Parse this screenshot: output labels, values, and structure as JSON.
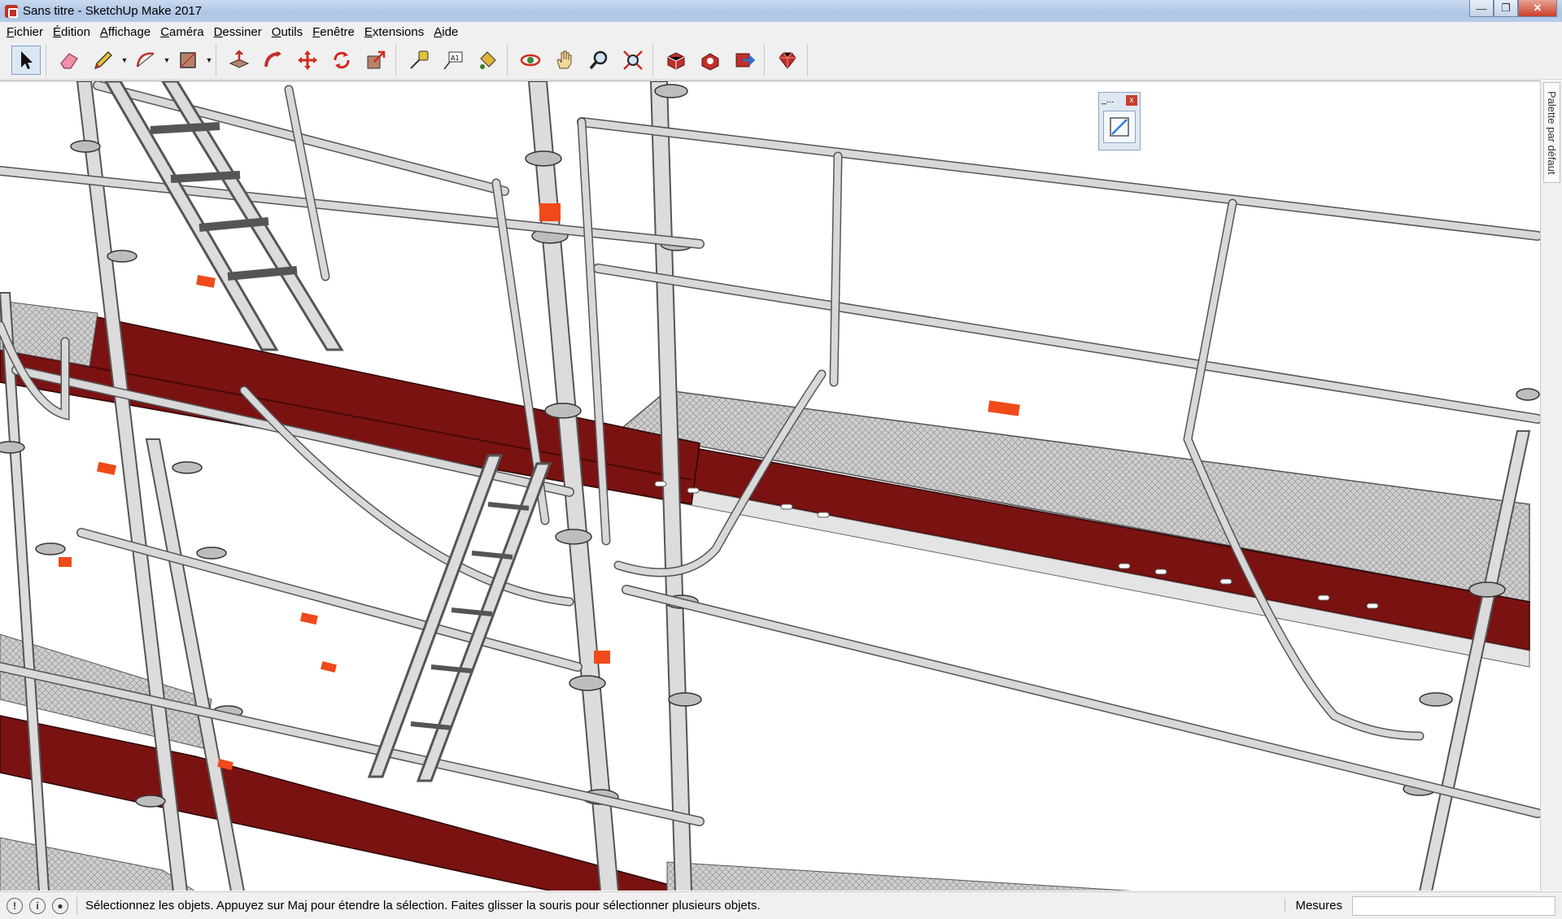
{
  "window": {
    "title": "Sans titre - SketchUp Make 2017",
    "minimize": "—",
    "maximize": "❐",
    "close": "✕"
  },
  "menu": [
    "Fichier",
    "Édition",
    "Affichage",
    "Caméra",
    "Dessiner",
    "Outils",
    "Fenêtre",
    "Extensions",
    "Aide"
  ],
  "toolbar": {
    "tools": [
      "select-tool",
      "eraser-tool",
      "line-tool",
      "arc-tool",
      "rectangle-tool",
      "push-pull-tool",
      "follow-me-tool",
      "move-tool",
      "rotate-tool",
      "scale-tool",
      "tape-measure-tool",
      "text-tool",
      "paint-bucket-tool",
      "orbit-tool",
      "pan-tool",
      "zoom-tool",
      "zoom-extents-tool",
      "warehouse-tool",
      "extension-warehouse-tool",
      "share-model-tool",
      "ruby-tool"
    ]
  },
  "mini_window": {
    "title": "_...",
    "close": "x"
  },
  "tray": {
    "tab_label": "Palette par défaut"
  },
  "status": {
    "message": "Sélectionnez les objets. Appuyez sur Maj pour étendre la sélection. Faites glisser la souris pour sélectionner plusieurs objets.",
    "measure_label": "Mesures",
    "measure_value": ""
  },
  "colors": {
    "deck_red": "#7a1212",
    "deck_red_dark": "#5e0b0b",
    "tube": "#d8d8d8",
    "tube_edge": "#5a5a5a",
    "marker_orange": "#f04a1a",
    "grating": "#c9c9c9"
  }
}
